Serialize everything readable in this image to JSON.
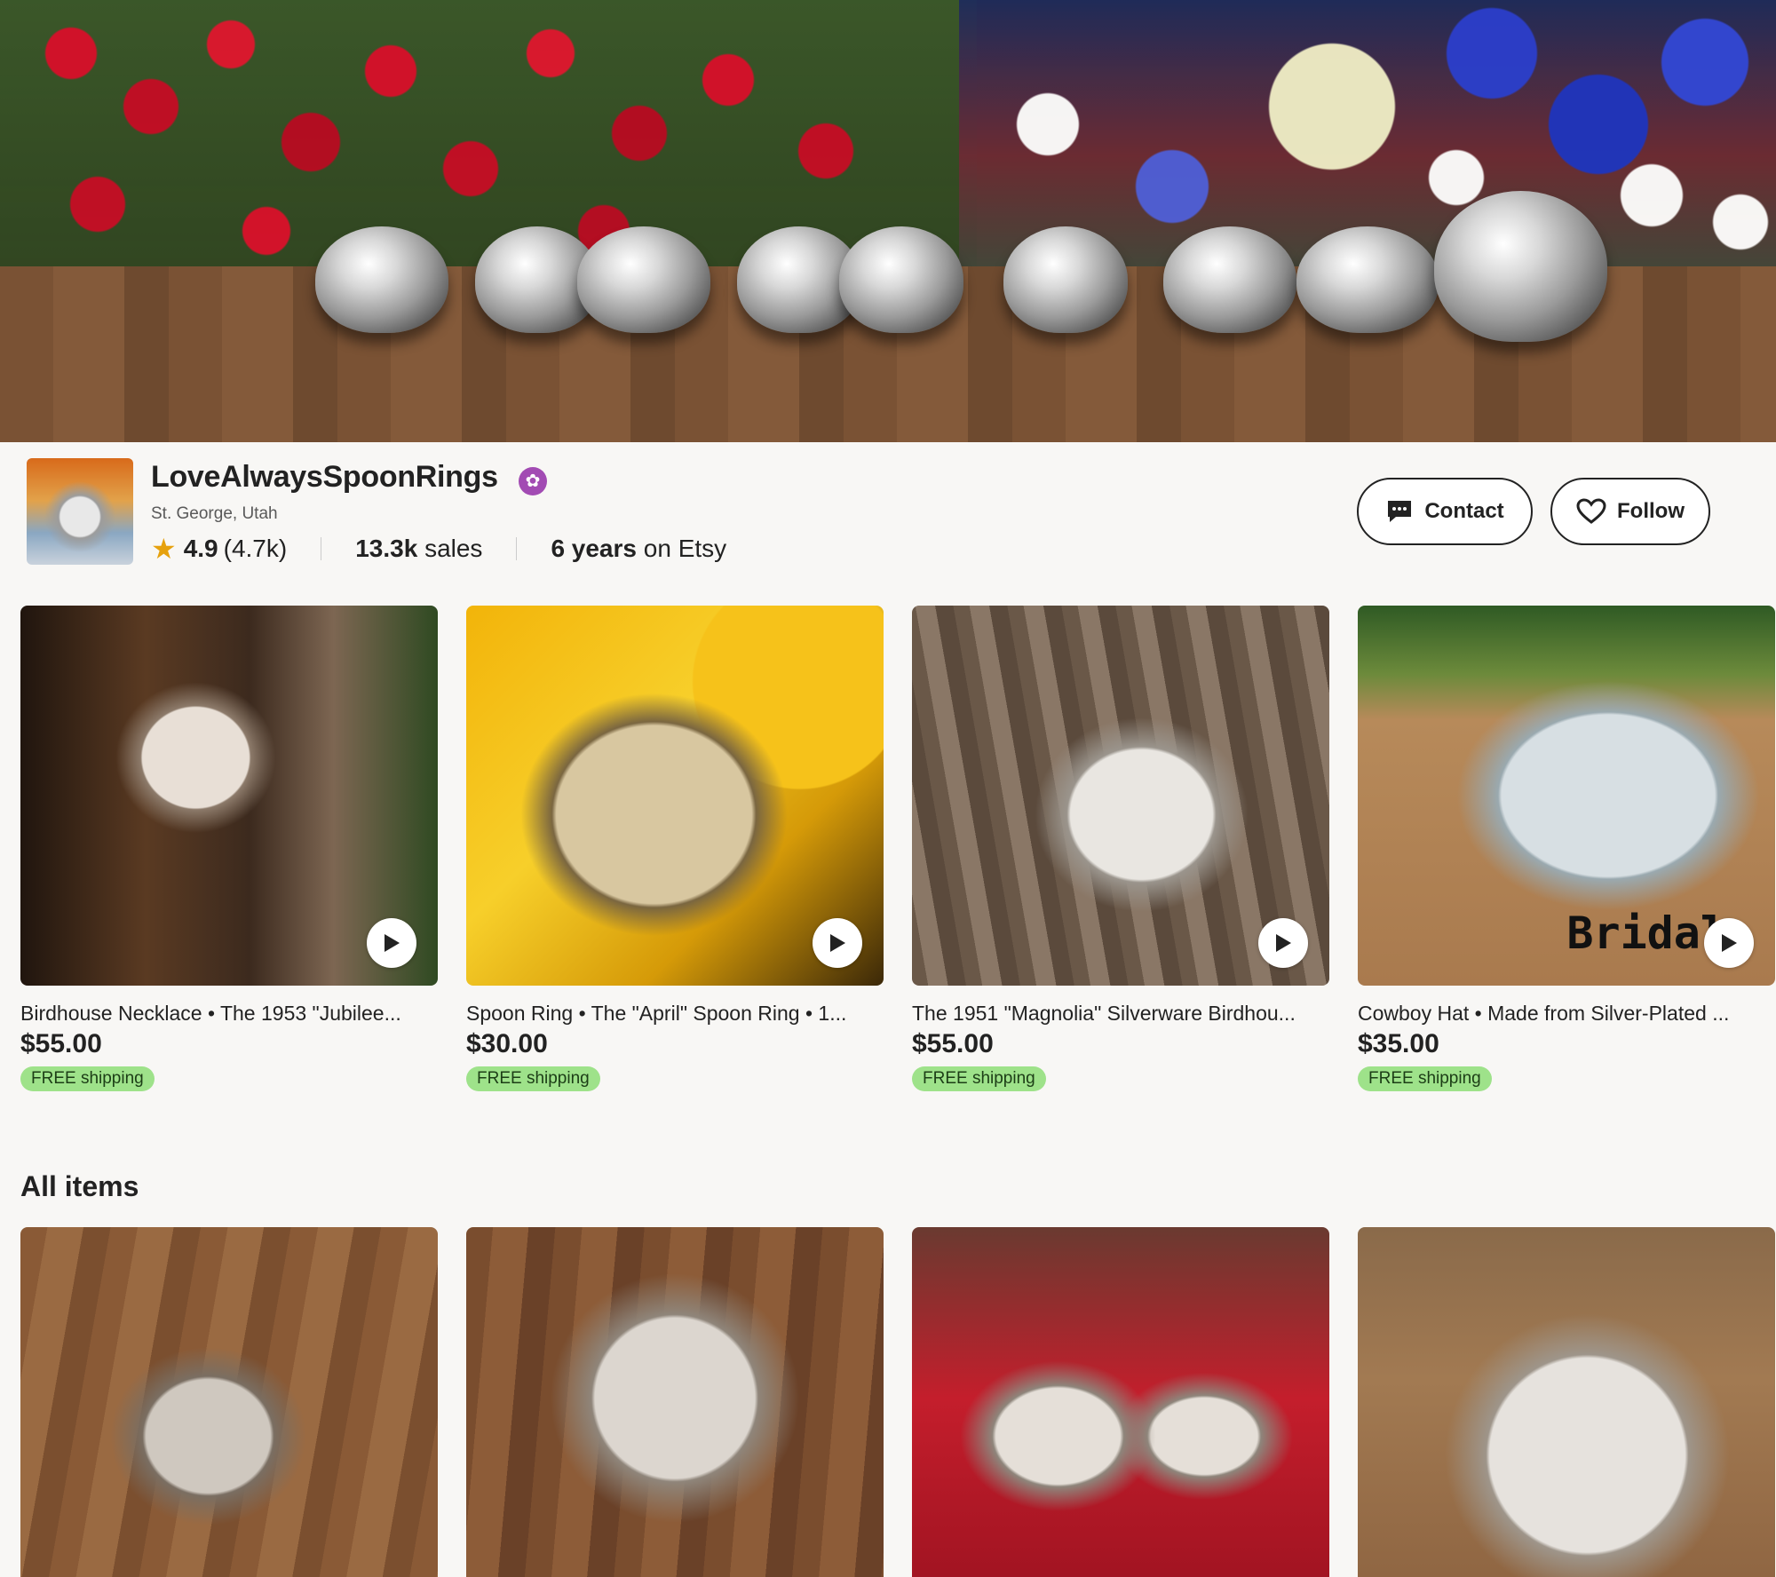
{
  "shop": {
    "name": "LoveAlwaysSpoonRings",
    "location": "St. George, Utah",
    "rating": "4.9",
    "rating_count": "(4.7k)",
    "sales_number": "13.3k",
    "sales_label": "sales",
    "years_number": "6 years",
    "years_label": "on Etsy",
    "star_seller_icon": "star-seller-badge",
    "rating_icon": "star-icon"
  },
  "actions": {
    "contact_label": "Contact",
    "follow_label": "Follow"
  },
  "featured": [
    {
      "title": "Birdhouse Necklace • The 1953 \"Jubilee...",
      "price": "$55.00",
      "shipping": "FREE shipping",
      "has_video": true
    },
    {
      "title": "Spoon Ring • The \"April\" Spoon Ring • 1...",
      "price": "$30.00",
      "shipping": "FREE shipping",
      "has_video": true
    },
    {
      "title": "The 1951 \"Magnolia\" Silverware Birdhou...",
      "price": "$55.00",
      "shipping": "FREE shipping",
      "has_video": true
    },
    {
      "title": "Cowboy Hat • Made from Silver-Plated ...",
      "price": "$35.00",
      "shipping": "FREE shipping",
      "has_video": true,
      "image_text": "Bridal"
    }
  ],
  "all_items": {
    "heading": "All items"
  },
  "colors": {
    "accent_purple": "#a24bb3",
    "star_orange": "#e6a10d",
    "shipping_green": "#9ee28a"
  }
}
